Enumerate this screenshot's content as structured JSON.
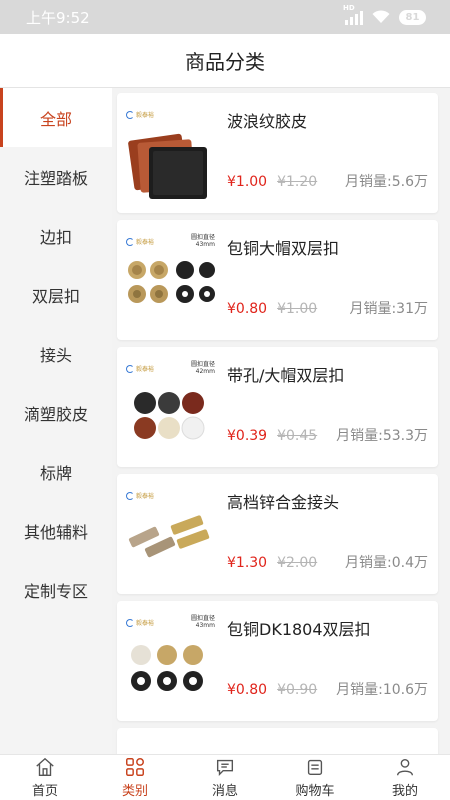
{
  "status": {
    "time": "上午9:52",
    "signal_label": "HD",
    "battery": "81"
  },
  "header": {
    "title": "商品分类"
  },
  "sidebar": {
    "active_color": "#c8431e",
    "items": [
      {
        "label": "全部"
      },
      {
        "label": "注塑踏板"
      },
      {
        "label": "边扣"
      },
      {
        "label": "双层扣"
      },
      {
        "label": "接头"
      },
      {
        "label": "滴塑胶皮"
      },
      {
        "label": "标牌"
      },
      {
        "label": "其他辅料"
      },
      {
        "label": "定制专区"
      }
    ]
  },
  "products": [
    {
      "name": "波浪纹胶皮",
      "price": "¥1.00",
      "old_price": "¥1.20",
      "sales": "月销量:5.6万",
      "brand": "毅泰裕",
      "spec": ""
    },
    {
      "name": "包铜大帽双层扣",
      "price": "¥0.80",
      "old_price": "¥1.00",
      "sales": "月销量:31万",
      "brand": "毅泰裕",
      "spec": "圆扣直径 43mm"
    },
    {
      "name": "带孔/大帽双层扣",
      "price": "¥0.39",
      "old_price": "¥0.45",
      "sales": "月销量:53.3万",
      "brand": "毅泰裕",
      "spec": "圆扣直径 42mm"
    },
    {
      "name": "高档锌合金接头",
      "price": "¥1.30",
      "old_price": "¥2.00",
      "sales": "月销量:0.4万",
      "brand": "毅泰裕",
      "spec": ""
    },
    {
      "name": "包铜DK1804双层扣",
      "price": "¥0.80",
      "old_price": "¥0.90",
      "sales": "月销量:10.6万",
      "brand": "毅泰裕",
      "spec": "圆扣直径 43mm"
    }
  ],
  "tabbar": {
    "active_color": "#c8431e",
    "items": [
      {
        "label": "首页",
        "icon": "home-icon"
      },
      {
        "label": "类别",
        "icon": "category-icon"
      },
      {
        "label": "消息",
        "icon": "message-icon"
      },
      {
        "label": "购物车",
        "icon": "cart-icon"
      },
      {
        "label": "我的",
        "icon": "profile-icon"
      }
    ]
  },
  "colors": {
    "price": "#e0241b",
    "brand": "#c8431e"
  }
}
